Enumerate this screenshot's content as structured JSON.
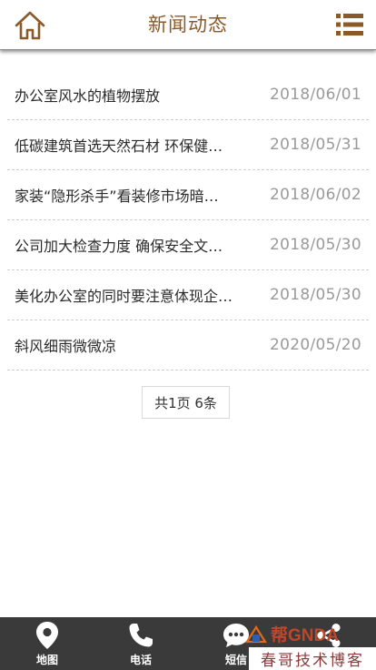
{
  "header": {
    "title": "新闻动态",
    "home_icon": "home-icon",
    "menu_icon": "menu-icon",
    "accent_color": "#8a5a2b"
  },
  "news": [
    {
      "title": "办公室风水的植物摆放",
      "date": "2018/06/01"
    },
    {
      "title": "低碳建筑首选天然石材 环保健…",
      "date": "2018/05/31"
    },
    {
      "title": "家装“隐形杀手”看装修市场暗…",
      "date": "2018/06/02"
    },
    {
      "title": "公司加大检查力度 确保安全文…",
      "date": "2018/05/30"
    },
    {
      "title": "美化办公室的同时要注意体现企…",
      "date": "2018/05/30"
    },
    {
      "title": "斜风细雨微微凉",
      "date": "2020/05/20"
    }
  ],
  "pager": {
    "text": "共1页 6条"
  },
  "bottom_nav": [
    {
      "label": "地图",
      "icon": "map-pin-icon"
    },
    {
      "label": "电话",
      "icon": "phone-icon"
    },
    {
      "label": "短信",
      "icon": "message-icon"
    },
    {
      "label": "",
      "icon": "share-icon"
    }
  ],
  "watermark": {
    "text": "春哥技术博客",
    "logo_text": "帮GNDA"
  }
}
